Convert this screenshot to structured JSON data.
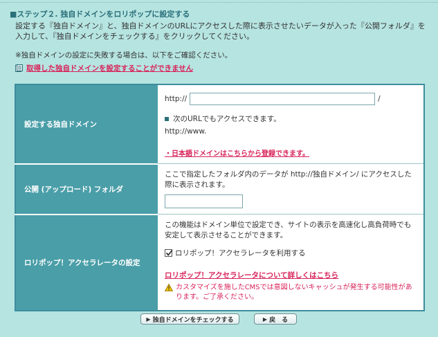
{
  "step": {
    "title": "■ステップ２. 独自ドメインをロリポップに設定する",
    "intro": "設定する『独自ドメイン』と、独自ドメインのURLにアクセスした際に表示させたいデータが入った『公開フォルダ』を入力して、『独自ドメインをチェックする』をクリックしてください。",
    "notice": "※独自ドメインの設定に失敗する場合は、以下をご確認ください。",
    "help_link": "取得した独自ドメインを設定することができません"
  },
  "form": {
    "domain": {
      "label": "設定する独自ドメイン",
      "prefix": "http://",
      "value": "",
      "suffix": "/",
      "alt_note": "次のURLでもアクセスできます。",
      "alt_url": "http://www.",
      "jp_link": "・日本語ドメインはこちらから登録できます。"
    },
    "folder": {
      "label": "公開 (アップロード) フォルダ",
      "description": "ここで指定したフォルダ内のデータが http://独自ドメイン/ にアクセスした際に表示されます。",
      "value": ""
    },
    "accelerator": {
      "label": "ロリポップ！アクセラレータの設定",
      "description": "この機能はドメイン単位で設定でき、サイトの表示を高速化し高負荷時でも安定して表示させることができます。",
      "checkbox_label": "ロリポップ！アクセラレータを利用する",
      "checked": true,
      "details_link": "ロリポップ！アクセラレータについて詳しくはこちら",
      "warning": "カスタマイズを施したCMSでは意図しないキャッシュが発生する可能性があります。ご了承ください。"
    }
  },
  "buttons": {
    "check": "独自ドメインをチェックする",
    "back": "戻　る"
  },
  "colors": {
    "background": "#b6e4e1",
    "header_cell": "#4a9ea8",
    "link": "#d8245b",
    "title": "#2a6f7a"
  },
  "icons": {
    "help": "book-icon",
    "bullet": "square-icon",
    "check": "checkbox-checked-icon",
    "warning": "warning-icon",
    "button_arrow": "arrow-right-icon"
  }
}
